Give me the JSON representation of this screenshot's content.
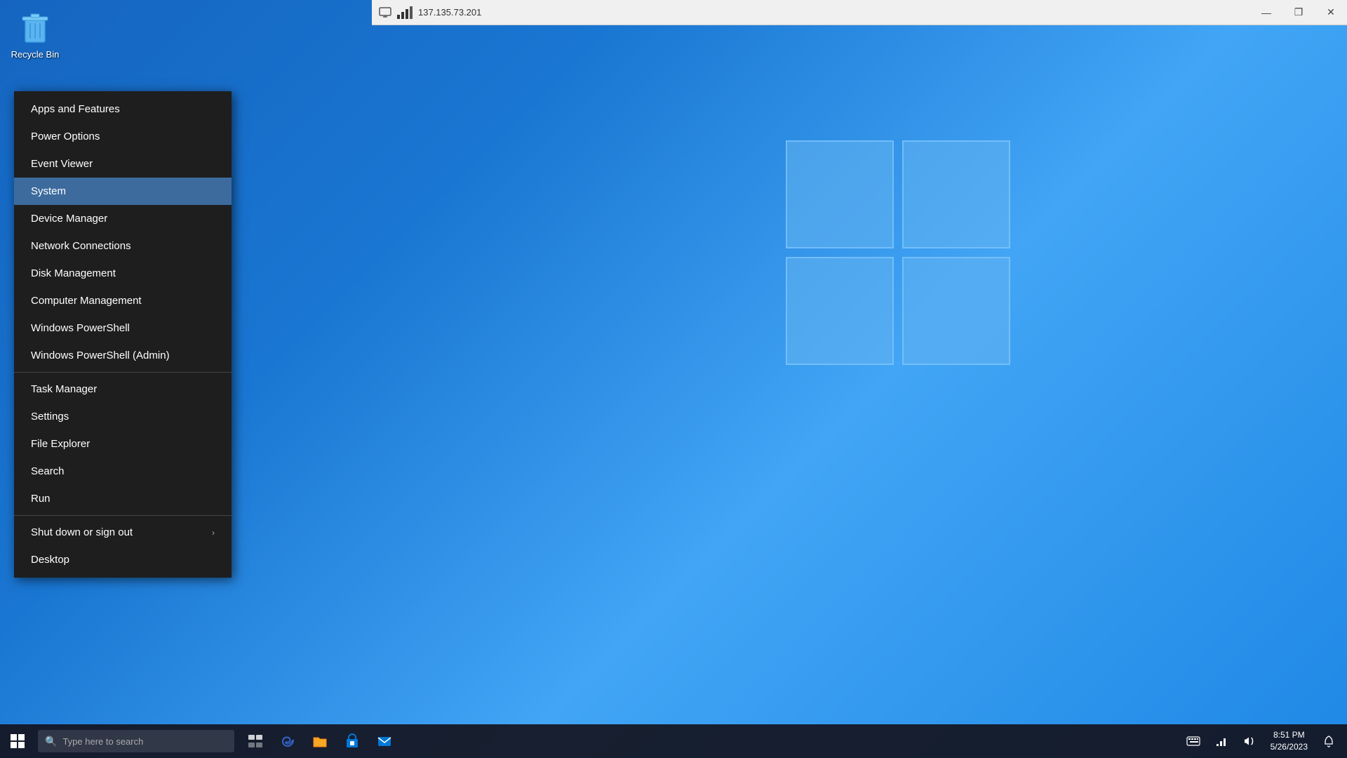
{
  "desktop": {
    "background_color": "#1565c0"
  },
  "recycle_bin": {
    "label": "Recycle Bin"
  },
  "remote_titlebar": {
    "ip": "137.135.73.201",
    "minimize": "—",
    "maximize": "❐",
    "close": "✕"
  },
  "context_menu": {
    "items": [
      {
        "id": "apps-features",
        "label": "Apps and Features",
        "separator_before": false,
        "arrow": false,
        "active": false
      },
      {
        "id": "power-options",
        "label": "Power Options",
        "separator_before": false,
        "arrow": false,
        "active": false
      },
      {
        "id": "event-viewer",
        "label": "Event Viewer",
        "separator_before": false,
        "arrow": false,
        "active": false
      },
      {
        "id": "system",
        "label": "System",
        "separator_before": false,
        "arrow": false,
        "active": true
      },
      {
        "id": "device-manager",
        "label": "Device Manager",
        "separator_before": false,
        "arrow": false,
        "active": false
      },
      {
        "id": "network-connections",
        "label": "Network Connections",
        "separator_before": false,
        "arrow": false,
        "active": false
      },
      {
        "id": "disk-management",
        "label": "Disk Management",
        "separator_before": false,
        "arrow": false,
        "active": false
      },
      {
        "id": "computer-management",
        "label": "Computer Management",
        "separator_before": false,
        "arrow": false,
        "active": false
      },
      {
        "id": "windows-powershell",
        "label": "Windows PowerShell",
        "separator_before": false,
        "arrow": false,
        "active": false
      },
      {
        "id": "windows-powershell-admin",
        "label": "Windows PowerShell (Admin)",
        "separator_before": false,
        "arrow": false,
        "active": false
      },
      {
        "id": "task-manager",
        "label": "Task Manager",
        "separator_before": true,
        "arrow": false,
        "active": false
      },
      {
        "id": "settings",
        "label": "Settings",
        "separator_before": false,
        "arrow": false,
        "active": false
      },
      {
        "id": "file-explorer",
        "label": "File Explorer",
        "separator_before": false,
        "arrow": false,
        "active": false
      },
      {
        "id": "search",
        "label": "Search",
        "separator_before": false,
        "arrow": false,
        "active": false
      },
      {
        "id": "run",
        "label": "Run",
        "separator_before": false,
        "arrow": false,
        "active": false
      },
      {
        "id": "shut-down",
        "label": "Shut down or sign out",
        "separator_before": true,
        "arrow": true,
        "active": false
      },
      {
        "id": "desktop",
        "label": "Desktop",
        "separator_before": false,
        "arrow": false,
        "active": false
      }
    ]
  },
  "taskbar": {
    "search_placeholder": "Type here to search",
    "time": "8:51 PM",
    "date": "5/26/2023"
  }
}
